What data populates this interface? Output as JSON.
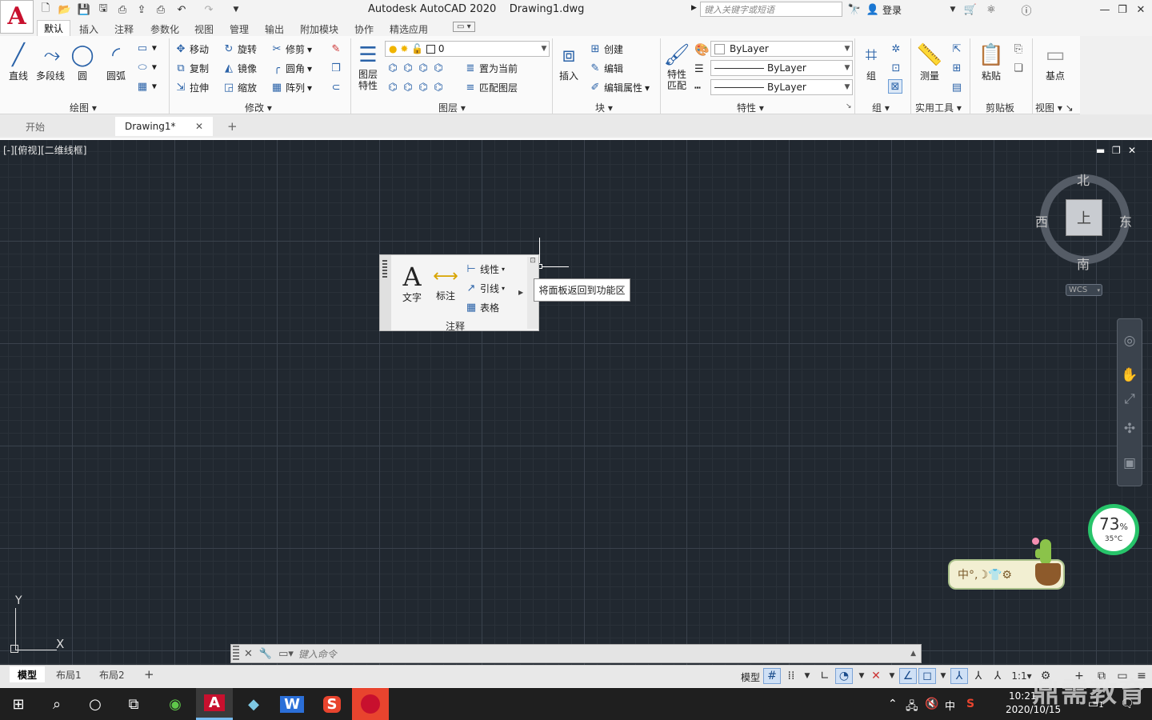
{
  "app": {
    "title": "Autodesk AutoCAD 2020",
    "file": "Drawing1.dwg",
    "search_placeholder": "键入关键字或短语",
    "login": "登录"
  },
  "ribbon_tabs": [
    "默认",
    "插入",
    "注释",
    "参数化",
    "视图",
    "管理",
    "输出",
    "附加模块",
    "协作",
    "精选应用"
  ],
  "panels": {
    "draw": {
      "label": "绘图",
      "line": "直线",
      "polyline": "多段线",
      "circle": "圆",
      "arc": "圆弧"
    },
    "modify": {
      "label": "修改",
      "move": "移动",
      "rotate": "旋转",
      "trim": "修剪",
      "copy": "复制",
      "mirror": "镜像",
      "fillet": "圆角",
      "stretch": "拉伸",
      "scale": "缩放",
      "array": "阵列"
    },
    "layers": {
      "label": "图层",
      "properties": "图层\n特性",
      "current_layer": "0",
      "set_current": "置为当前",
      "match_layer": "匹配图层"
    },
    "block": {
      "label": "块",
      "insert": "插入",
      "create": "创建",
      "edit": "编辑",
      "edit_attr": "编辑属性"
    },
    "properties": {
      "label": "特性",
      "match": "特性\n匹配",
      "color": "ByLayer",
      "linetype": "ByLayer",
      "lineweight": "ByLayer"
    },
    "groups": {
      "label": "组",
      "group": "组"
    },
    "utilities": {
      "label": "实用工具",
      "measure": "测量"
    },
    "clipboard": {
      "label": "剪贴板",
      "paste": "粘贴"
    },
    "view": {
      "label": "视图",
      "base": "基点"
    }
  },
  "doc_tabs": [
    "开始",
    "Drawing1*"
  ],
  "viewport_label": "[-][俯视][二维线框]",
  "floating_panel": {
    "text": "文字",
    "dimension": "标注",
    "linear": "线性",
    "leader": "引线",
    "table": "表格",
    "label": "注释"
  },
  "tooltip": "将面板返回到功能区",
  "viewcube": {
    "north": "北",
    "south": "南",
    "east": "东",
    "west": "西",
    "top": "上",
    "wcs": "WCS"
  },
  "ucs": {
    "x": "X",
    "y": "Y"
  },
  "command_prompt": "键入命令",
  "layout_tabs": [
    "模型",
    "布局1",
    "布局2"
  ],
  "status": {
    "model": "模型",
    "scale": "1:1"
  },
  "widgets": {
    "cpu_percent": "73",
    "cpu_unit": "%",
    "temperature": "35°C",
    "ime": "中°,☽👕⚙"
  },
  "taskbar": {
    "time": "10:21",
    "date": "2020/10/15",
    "ime_indicator": "中",
    "badge": "1"
  },
  "watermark": "鼎需教育",
  "colors": {
    "accent": "#2a62a8",
    "canvas": "#212830",
    "logo": "#c8102e",
    "gauge": "#27c46a"
  }
}
